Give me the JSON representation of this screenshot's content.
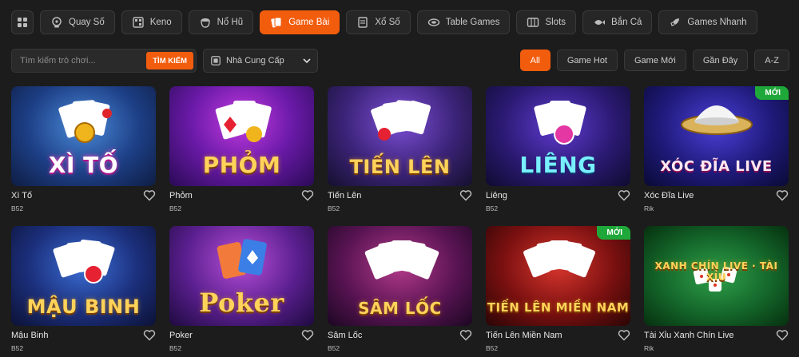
{
  "categories": [
    {
      "label": "",
      "icon": "grid-icon",
      "active": false
    },
    {
      "label": "Quay Số",
      "icon": "spin-icon",
      "active": false
    },
    {
      "label": "Keno",
      "icon": "keno-icon",
      "active": false
    },
    {
      "label": "Nổ Hũ",
      "icon": "jackpot-icon",
      "active": false
    },
    {
      "label": "Game Bài",
      "icon": "cards-icon",
      "active": true
    },
    {
      "label": "Xổ Số",
      "icon": "lottery-icon",
      "active": false
    },
    {
      "label": "Table Games",
      "icon": "table-icon",
      "active": false
    },
    {
      "label": "Slots",
      "icon": "slots-icon",
      "active": false
    },
    {
      "label": "Bắn Cá",
      "icon": "fish-icon",
      "active": false
    },
    {
      "label": "Games Nhanh",
      "icon": "rocket-icon",
      "active": false
    }
  ],
  "search": {
    "placeholder": "Tìm kiếm trò chơi...",
    "button": "TÌM KIẾM"
  },
  "provider": {
    "label": "Nhà Cung Cấp"
  },
  "filters": [
    {
      "label": "All",
      "active": true
    },
    {
      "label": "Game Hot",
      "active": false
    },
    {
      "label": "Game Mới",
      "active": false
    },
    {
      "label": "Gần Đây",
      "active": false
    },
    {
      "label": "A-Z",
      "active": false
    }
  ],
  "games": [
    {
      "title": "Xì Tố",
      "provider": "B52",
      "logo": "XÌ TỐ",
      "badge": ""
    },
    {
      "title": "Phỏm",
      "provider": "B52",
      "logo": "PHỎM",
      "badge": ""
    },
    {
      "title": "Tiến Lên",
      "provider": "B52",
      "logo": "TIẾN LÊN",
      "badge": ""
    },
    {
      "title": "Liêng",
      "provider": "B52",
      "logo": "LIÊNG",
      "badge": ""
    },
    {
      "title": "Xóc Đĩa Live",
      "provider": "Rik",
      "logo": "XÓC ĐĨA LIVE",
      "badge": "MỚI"
    },
    {
      "title": "Mậu Binh",
      "provider": "B52",
      "logo": "MẬU BINH",
      "badge": ""
    },
    {
      "title": "Poker",
      "provider": "B52",
      "logo": "Poker",
      "badge": ""
    },
    {
      "title": "Sâm Lốc",
      "provider": "B52",
      "logo": "SÂM LỐC",
      "badge": ""
    },
    {
      "title": "Tiến Lên Miền Nam",
      "provider": "B52",
      "logo": "TIẾN LÊN MIỀN NAM",
      "badge": "MỚI"
    },
    {
      "title": "Tài Xỉu Xanh Chín Live",
      "provider": "Rik",
      "logo": "XANH CHÍN LIVE · TÀI XỈU",
      "badge": ""
    }
  ],
  "colors": {
    "accent": "#f25c0d",
    "background": "#1c1c1c",
    "badge": "#1fa83a"
  }
}
